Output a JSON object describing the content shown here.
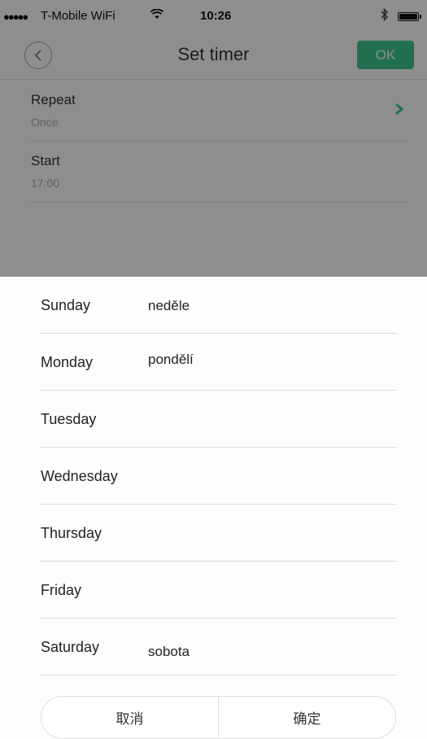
{
  "status_bar": {
    "signal": "●●●●●",
    "carrier": "T-Mobile WiFi",
    "wifi_glyph": "ᯤ",
    "time": "10:26",
    "bluetooth_glyph": "✱"
  },
  "nav": {
    "back_glyph": "〈",
    "title": "Set timer",
    "ok_label": "OK"
  },
  "settings": [
    {
      "label": "Repeat",
      "value": "Once"
    },
    {
      "label": "Start",
      "value": "17:00"
    }
  ],
  "days": [
    {
      "name": "Sunday",
      "note": "neděle"
    },
    {
      "name": "Monday",
      "note": "pondělí"
    },
    {
      "name": "Tuesday",
      "note": ""
    },
    {
      "name": "Wednesday",
      "note": ""
    },
    {
      "name": "Thursday",
      "note": ""
    },
    {
      "name": "Friday",
      "note": ""
    },
    {
      "name": "Saturday",
      "note": "sobota"
    }
  ],
  "actions": {
    "cancel_label": "取消",
    "confirm_label": "确定"
  },
  "colors": {
    "accent": "#3cc08a",
    "overlay": "#000000"
  }
}
